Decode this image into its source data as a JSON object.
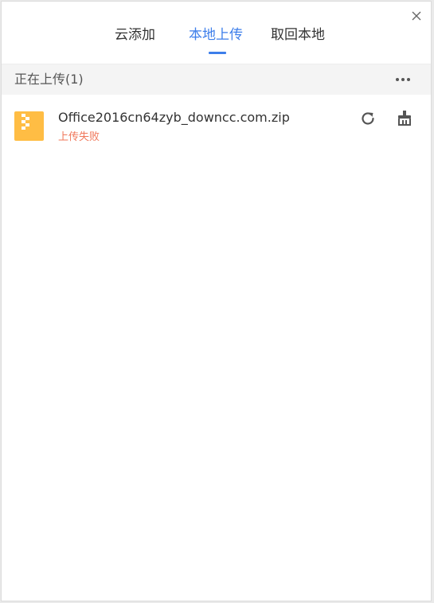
{
  "tabs": [
    {
      "label": "云添加",
      "active": false
    },
    {
      "label": "本地上传",
      "active": true
    },
    {
      "label": "取回本地",
      "active": false
    }
  ],
  "section": {
    "title": "正在上传(1)"
  },
  "uploads": [
    {
      "file_name": "Office2016cn64zyb_downcc.com.zip",
      "status": "上传失败",
      "file_icon": "zip-file-icon",
      "actions": [
        "retry-icon",
        "clear-icon"
      ]
    }
  ],
  "colors": {
    "accent": "#3d7eea",
    "error": "#f0775a",
    "file_icon": "#ffbd44"
  }
}
